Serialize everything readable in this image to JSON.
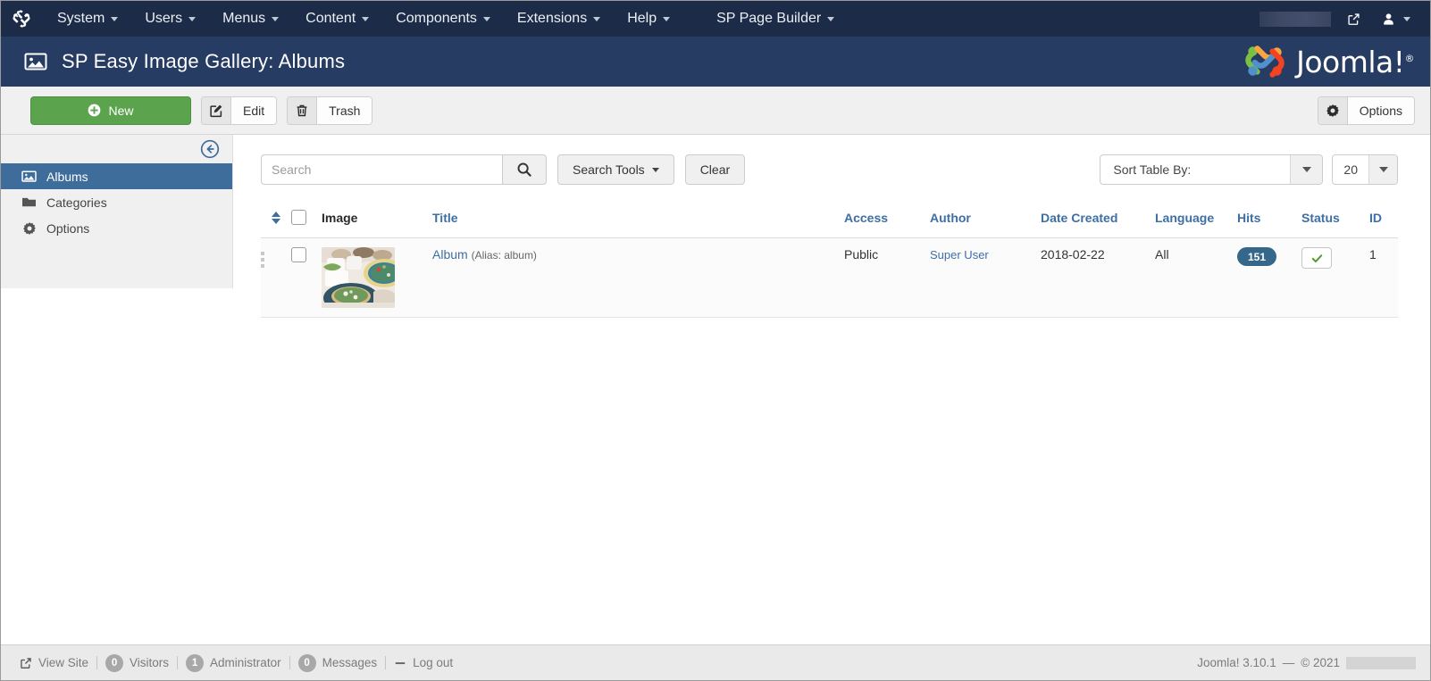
{
  "topbar": {
    "logo_icon": "joomla-logo-icon",
    "menu": [
      {
        "label": "System",
        "caret": true
      },
      {
        "label": "Users",
        "caret": true
      },
      {
        "label": "Menus",
        "caret": true
      },
      {
        "label": "Content",
        "caret": true
      },
      {
        "label": "Components",
        "caret": true
      },
      {
        "label": "Extensions",
        "caret": true
      },
      {
        "label": "Help",
        "caret": true
      },
      {
        "label": "SP Page Builder",
        "caret": true
      }
    ],
    "site_link_icon": "external-link-icon",
    "user_icon": "user-account-icon",
    "redacted": ""
  },
  "header": {
    "icon": "image-gallery-icon",
    "title": "SP Easy Image Gallery: Albums",
    "brand": "Joomla!",
    "brand_mark": "®"
  },
  "toolbar": {
    "new_label": "New",
    "new_icon": "plus-circle-icon",
    "edit_label": "Edit",
    "edit_icon": "pencil-square-icon",
    "trash_label": "Trash",
    "trash_icon": "trash-icon",
    "options_label": "Options",
    "options_icon": "gear-icon"
  },
  "sidebar": {
    "collapse_icon": "arrow-left-circle-icon",
    "items": [
      {
        "label": "Albums",
        "icon": "image-gallery-icon",
        "active": true
      },
      {
        "label": "Categories",
        "icon": "folder-icon",
        "active": false
      },
      {
        "label": "Options",
        "icon": "gear-icon",
        "active": false
      }
    ]
  },
  "filters": {
    "search_placeholder": "Search",
    "search_value": "",
    "search_icon": "search-icon",
    "search_tools_label": "Search Tools",
    "clear_label": "Clear",
    "sort_label": "Sort Table By:",
    "limit_value": "20"
  },
  "table": {
    "columns": {
      "ordering": "",
      "check": "",
      "image": "Image",
      "title": "Title",
      "access": "Access",
      "author": "Author",
      "date_created": "Date Created",
      "language": "Language",
      "hits": "Hits",
      "status": "Status",
      "id": "ID"
    },
    "rows": [
      {
        "drag_icon": "drag-handle-icon",
        "thumb_icon": "album-thumbnail-image",
        "title": "Album",
        "alias": "(Alias: album)",
        "access": "Public",
        "author": "Super User",
        "date_created": "2018-02-22",
        "language": "All",
        "hits": "151",
        "status_icon": "check-icon",
        "id": "1"
      }
    ]
  },
  "footer": {
    "view_site": "View Site",
    "view_site_icon": "external-link-icon",
    "visitors_count": "0",
    "visitors_label": "Visitors",
    "admin_count": "1",
    "admin_label": "Administrator",
    "messages_count": "0",
    "messages_label": "Messages",
    "logout_label": "Log out",
    "logout_icon": "minus-icon",
    "version": "Joomla! 3.10.1",
    "dash": "—",
    "copyright": "© 2021"
  },
  "colors": {
    "topbar": "#1c2b48",
    "header": "#273c63",
    "accent_link": "#3d6fa5",
    "sidebar_active": "#3e6d9c",
    "new_button": "#5ba34c",
    "hits_badge": "#34678a",
    "status_check": "#5a9b33"
  }
}
